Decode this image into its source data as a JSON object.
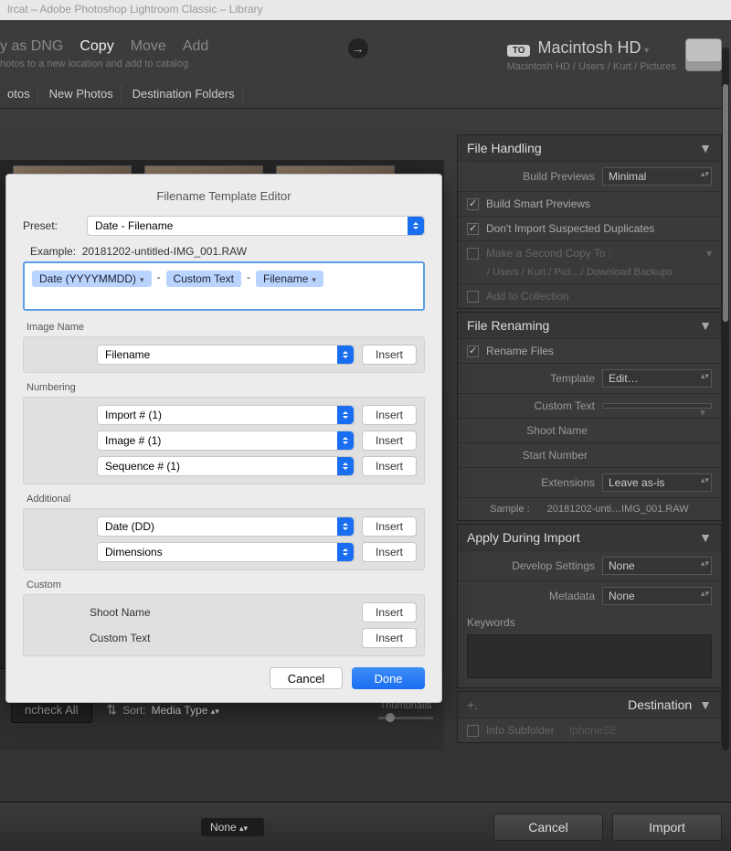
{
  "window": {
    "title": "lrcat – Adobe Photoshop Lightroom Classic – Library"
  },
  "toolbar": {
    "actions": {
      "copy_dng": "y as DNG",
      "copy": "Copy",
      "move": "Move",
      "add": "Add"
    },
    "hint": "hotos to a new location and add to catalog",
    "to_label": "TO",
    "destination": "Macintosh HD",
    "destination_path": "Macintosh HD / Users / Kurt / Pictures"
  },
  "tabs": {
    "t1": "otos",
    "t2": "New Photos",
    "t3": "Destination Folders"
  },
  "panels": {
    "file_handling": {
      "title": "File Handling",
      "build_previews_label": "Build Previews",
      "build_previews": "Minimal",
      "smart_previews": "Build Smart Previews",
      "no_dupes": "Don't Import Suspected Duplicates",
      "second_copy": "Make a Second Copy To :",
      "second_copy_path": "/ Users / Kurt / Pict…/ Download Backups",
      "add_collection": "Add to Collection"
    },
    "file_renaming": {
      "title": "File Renaming",
      "rename": "Rename Files",
      "template_label": "Template",
      "template": "Edit…",
      "custom_text_label": "Custom Text",
      "shoot_name_label": "Shoot Name",
      "start_number_label": "Start Number",
      "extensions_label": "Extensions",
      "extensions": "Leave as-is",
      "sample_label": "Sample :",
      "sample": "20181202-unti…IMG_001.RAW"
    },
    "apply_during": {
      "title": "Apply During Import",
      "develop_label": "Develop Settings",
      "develop": "None",
      "metadata_label": "Metadata",
      "metadata": "None",
      "keywords_label": "Keywords"
    },
    "destination": {
      "title": "Destination",
      "into_sub_label": "Into Subfolder",
      "into_sub": "IphoneSE"
    }
  },
  "dialog": {
    "title": "Filename Template Editor",
    "preset_label": "Preset:",
    "preset": "Date - Filename",
    "example_label": "Example:",
    "example": "20181202-untitled-IMG_001.RAW",
    "tokens": {
      "date": "Date (YYYYMMDD)",
      "custom": "Custom Text",
      "filename": "Filename"
    },
    "groups": {
      "image_name": {
        "title": "Image Name",
        "opt1": "Filename"
      },
      "numbering": {
        "title": "Numbering",
        "opt1": "Import # (1)",
        "opt2": "Image # (1)",
        "opt3": "Sequence # (1)"
      },
      "additional": {
        "title": "Additional",
        "opt1": "Date (DD)",
        "opt2": "Dimensions"
      },
      "custom": {
        "title": "Custom",
        "shoot": "Shoot Name",
        "text": "Custom Text"
      }
    },
    "insert": "Insert",
    "cancel": "Cancel",
    "done": "Done"
  },
  "bottom": {
    "uncheck": "ncheck All",
    "sort_label": "Sort:",
    "sort_value": "Media Type",
    "thumbnails": "Thumbnails"
  },
  "footer": {
    "none": "None",
    "cancel": "Cancel",
    "import": "Import"
  }
}
